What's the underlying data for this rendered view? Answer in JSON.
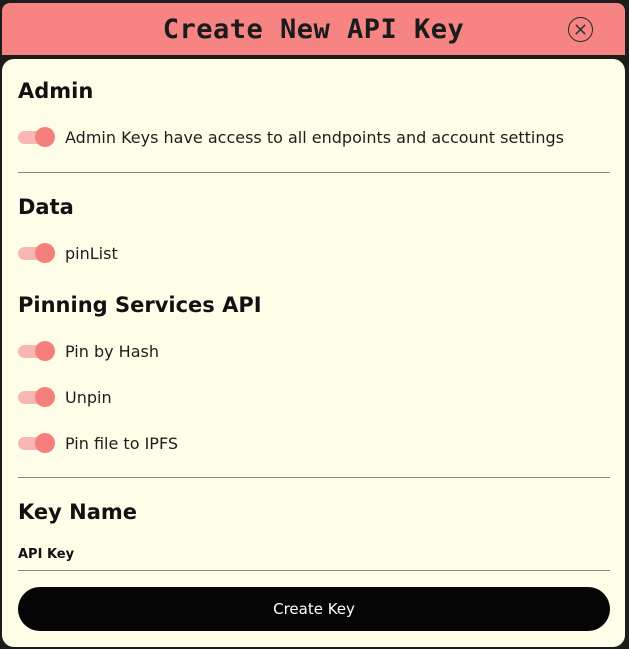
{
  "header": {
    "title": "Create New API Key",
    "close_icon": "close-circle-icon"
  },
  "sections": {
    "admin": {
      "title": "Admin",
      "toggles": [
        {
          "label": "Admin Keys have access to all endpoints and account settings",
          "on": true
        }
      ]
    },
    "data": {
      "title": "Data",
      "toggles": [
        {
          "label": "pinList",
          "on": true
        }
      ]
    },
    "pinning": {
      "title": "Pinning Services API",
      "toggles": [
        {
          "label": "Pin by Hash",
          "on": true
        },
        {
          "label": "Unpin",
          "on": true
        },
        {
          "label": "Pin file to IPFS",
          "on": true
        }
      ]
    },
    "key_name": {
      "title": "Key Name",
      "field_label": "API Key",
      "value": "",
      "placeholder": ""
    }
  },
  "footer": {
    "create_label": "Create Key"
  },
  "colors": {
    "header_bg": "#f58482",
    "panel_bg": "#fefde8",
    "toggle_knob": "#f57f7d",
    "toggle_track": "#f9b7b3",
    "button_bg": "#050505"
  }
}
